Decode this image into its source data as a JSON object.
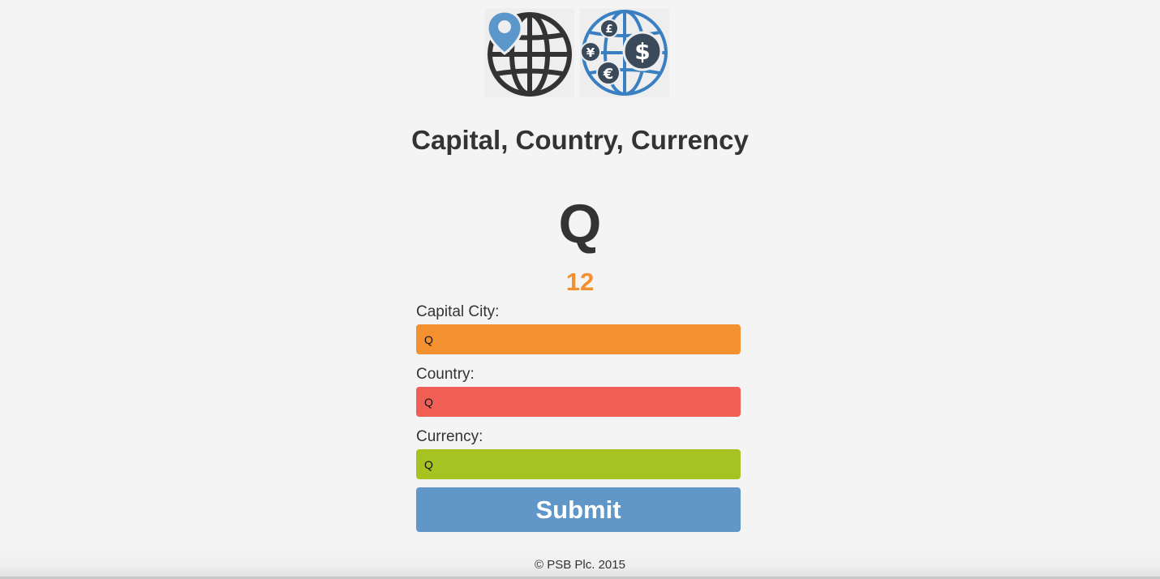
{
  "header": {
    "title": "Capital, Country, Currency",
    "logos": {
      "left_icon": "globe-location-pin-icon",
      "right_icon": "globe-currency-icon",
      "currency_symbols": [
        "£",
        "¥",
        "$",
        "€"
      ]
    }
  },
  "game": {
    "letter": "Q",
    "score": "12",
    "score_color": "#f39131"
  },
  "form": {
    "fields": [
      {
        "label": "Capital City:",
        "value": "Q",
        "color": "#f39131"
      },
      {
        "label": "Country:",
        "value": "Q",
        "color": "#ef5f55"
      },
      {
        "label": "Currency:",
        "value": "Q",
        "color": "#a6c321"
      }
    ],
    "submit_label": "Submit",
    "submit_color": "#6097c8"
  },
  "footer": {
    "text": "© PSB Plc. 2015"
  }
}
